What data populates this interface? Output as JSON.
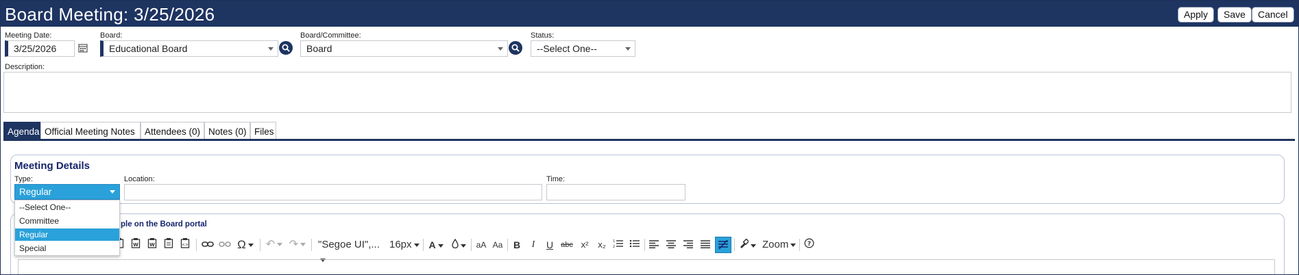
{
  "header": {
    "title": "Board Meeting: 3/25/2026",
    "apply_label": "Apply",
    "save_label": "Save",
    "cancel_label": "Cancel",
    "background_color": "#1e3461"
  },
  "form": {
    "meeting_date_label": "Meeting Date:",
    "meeting_date_value": "3/25/2026",
    "board_label": "Board:",
    "board_value": "Educational Board",
    "committee_label": "Board/Committee:",
    "committee_value": "Board",
    "status_label": "Status:",
    "status_value": "--Select One--",
    "description_label": "Description:",
    "description_value": ""
  },
  "tabs": [
    {
      "label": "Agenda",
      "active": true
    },
    {
      "label": "Official Meeting Notes",
      "active": false
    },
    {
      "label": "Attendees (0)",
      "active": false
    },
    {
      "label": "Notes (0)",
      "active": false
    },
    {
      "label": "Files",
      "active": false
    }
  ],
  "meeting_details": {
    "title": "Meeting Details",
    "type_label": "Type:",
    "type_value": "Regular",
    "type_options": [
      "--Select One--",
      "Committee",
      "Regular",
      "Special"
    ],
    "type_selected_index": 2,
    "location_label": "Location:",
    "location_value": "",
    "time_label": "Time:",
    "time_value": ""
  },
  "portal_section": {
    "note_partial": "ple on the Board portal"
  },
  "editor_toolbar": {
    "font_family": "\"Segoe UI\",...",
    "font_size": "16px",
    "zoom_label": "Zoom",
    "icons": [
      "paste-icon",
      "paste-word-icon",
      "paste-text-icon",
      "paste-html-icon",
      "link-icon",
      "unlink-icon",
      "special-char-icon",
      "undo-icon",
      "redo-icon",
      "font-color-icon",
      "highlight-icon",
      "grow-font-icon",
      "shrink-font-icon",
      "bold-icon",
      "italic-icon",
      "underline-icon",
      "strike-icon",
      "superscript-icon",
      "subscript-icon",
      "ordered-list-icon",
      "bullet-list-icon",
      "align-left-icon",
      "align-center-icon",
      "align-right-icon",
      "justify-icon",
      "clear-format-icon",
      "format-painter-icon",
      "help-icon"
    ],
    "accent_color": "#2aa1da"
  }
}
